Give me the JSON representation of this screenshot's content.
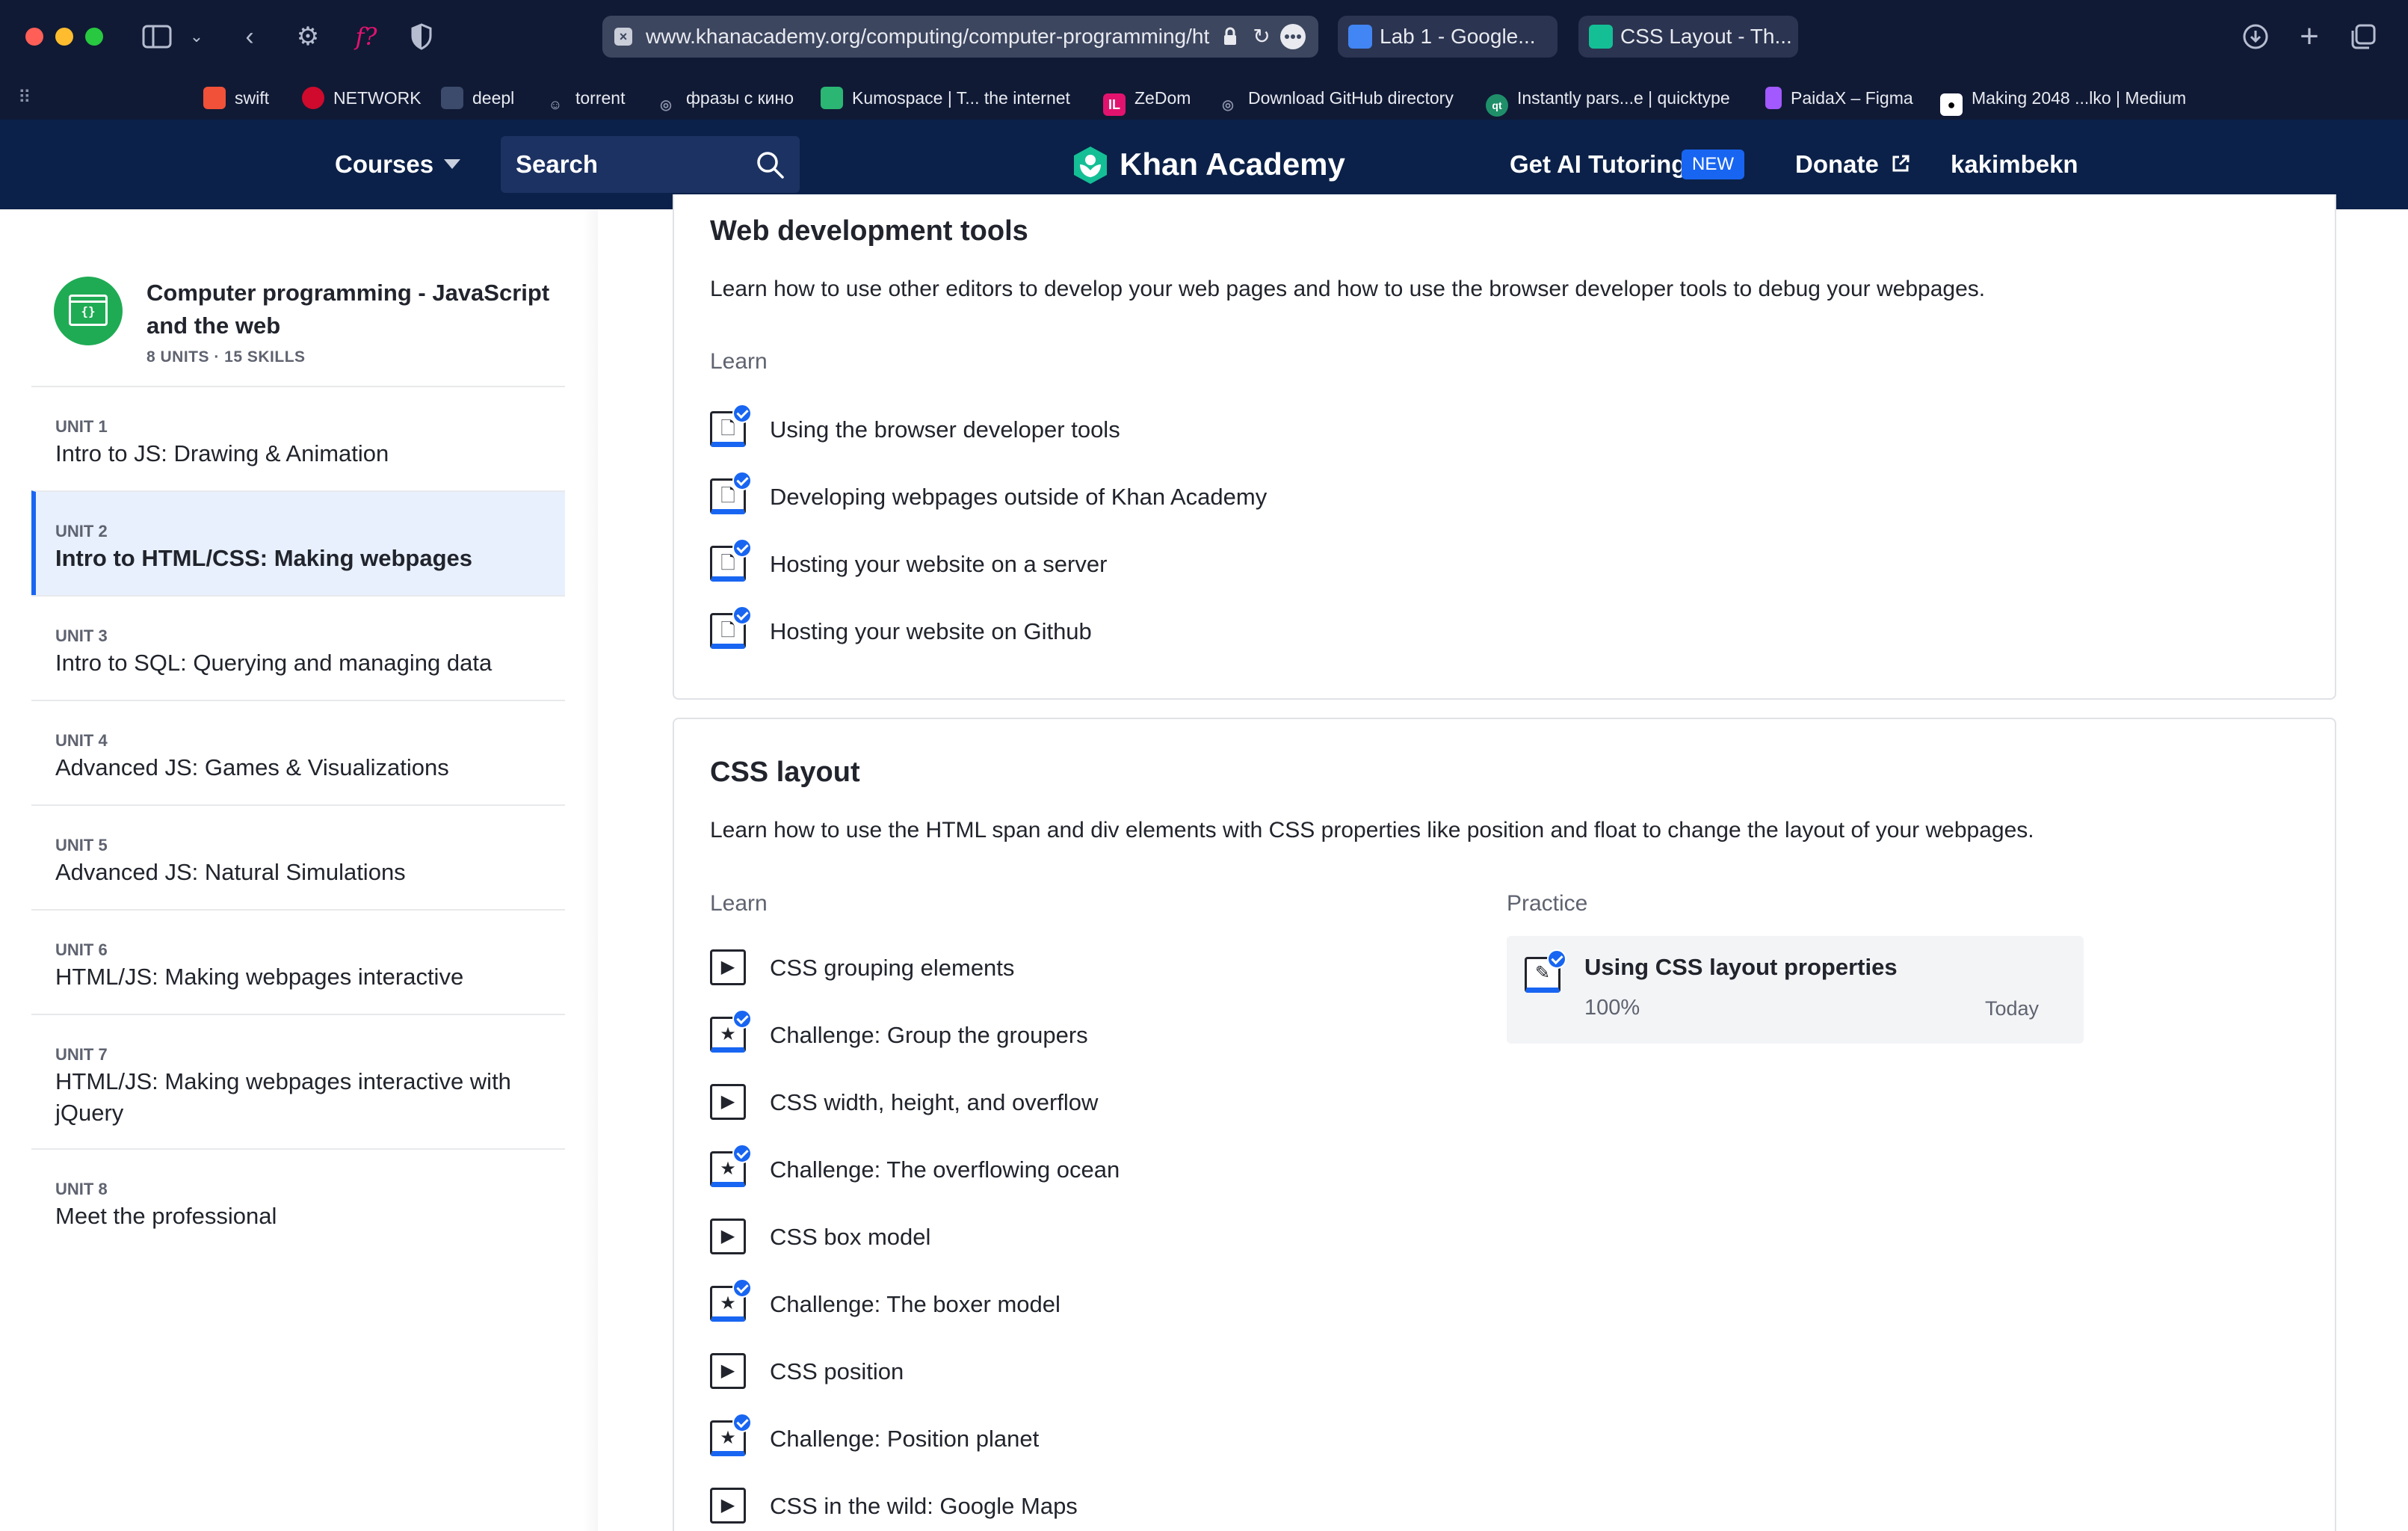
{
  "browser": {
    "url": "www.khanacademy.org/computing/computer-programming/ht",
    "tabs": [
      {
        "label": "Lab 1 - Google...",
        "favicon_color": "#4285f4"
      },
      {
        "label": "CSS Layout - Th...",
        "favicon_color": "#14bf96"
      }
    ],
    "bookmarks": [
      {
        "label": "swift",
        "icon_color": "#f05138"
      },
      {
        "label": "NETWORK",
        "icon_color": "#cf0a2c"
      },
      {
        "label": "deepl",
        "icon_color": "#3c4a6b"
      },
      {
        "label": "torrent",
        "icon_color": "#6f7890"
      },
      {
        "label": "фразы с кино",
        "icon_color": "#6f7890"
      },
      {
        "label": "Kumospace | T... the internet",
        "icon_color": "#2bb673"
      },
      {
        "label": "ZeDom",
        "icon_color": "#e2136e"
      },
      {
        "label": "Download GitHub directory",
        "icon_color": "#6f7890"
      },
      {
        "label": "Instantly pars...e | quicktype",
        "icon_color": "#1f8f6a"
      },
      {
        "label": "PaidaX – Figma",
        "icon_color": "#a259ff"
      },
      {
        "label": "Making 2048 ...lko | Medium",
        "icon_color": "#ffffff"
      }
    ]
  },
  "header": {
    "courses_label": "Courses",
    "search_placeholder": "Search",
    "logo_text": "Khan Academy",
    "ai_tutoring_label": "Get AI Tutoring",
    "new_badge": "NEW",
    "donate_label": "Donate",
    "username": "kakimbekn",
    "brand_color": "#0b2149",
    "accent_color": "#1865f2"
  },
  "sidebar": {
    "course_title": "Computer programming - JavaScript and the web",
    "course_meta": "8 UNITS · 15 SKILLS",
    "units": [
      {
        "label": "UNIT 1",
        "title": "Intro to JS: Drawing & Animation",
        "active": false
      },
      {
        "label": "UNIT 2",
        "title": "Intro to HTML/CSS: Making webpages",
        "active": true
      },
      {
        "label": "UNIT 3",
        "title": "Intro to SQL: Querying and managing data",
        "active": false
      },
      {
        "label": "UNIT 4",
        "title": "Advanced JS: Games & Visualizations",
        "active": false
      },
      {
        "label": "UNIT 5",
        "title": "Advanced JS: Natural Simulations",
        "active": false
      },
      {
        "label": "UNIT 6",
        "title": "HTML/JS: Making webpages interactive",
        "active": false
      },
      {
        "label": "UNIT 7",
        "title": "HTML/JS: Making webpages interactive with jQuery",
        "active": false
      },
      {
        "label": "UNIT 8",
        "title": "Meet the professional",
        "active": false
      }
    ]
  },
  "lessons": [
    {
      "title": "Web development tools",
      "description": "Learn how to use other editors to develop your web pages and how to use the browser developer tools to debug your webpages.",
      "learn_label": "Learn",
      "items": [
        {
          "label": "Using the browser developer tools",
          "type": "article",
          "completed": true
        },
        {
          "label": "Developing webpages outside of Khan Academy",
          "type": "article",
          "completed": true
        },
        {
          "label": "Hosting your website on a server",
          "type": "article",
          "completed": true
        },
        {
          "label": "Hosting your website on Github",
          "type": "article",
          "completed": true
        }
      ]
    },
    {
      "title": "CSS layout",
      "description": "Learn how to use the HTML span and div elements with CSS properties like position and float to change the layout of your webpages.",
      "learn_label": "Learn",
      "practice_label": "Practice",
      "items": [
        {
          "label": "CSS grouping elements",
          "type": "video",
          "completed": false
        },
        {
          "label": "Challenge: Group the groupers",
          "type": "challenge",
          "completed": true
        },
        {
          "label": "CSS width, height, and overflow",
          "type": "video",
          "completed": false
        },
        {
          "label": "Challenge: The overflowing ocean",
          "type": "challenge",
          "completed": true
        },
        {
          "label": "CSS box model",
          "type": "video",
          "completed": false
        },
        {
          "label": "Challenge: The boxer model",
          "type": "challenge",
          "completed": true
        },
        {
          "label": "CSS position",
          "type": "video",
          "completed": false
        },
        {
          "label": "Challenge: Position planet",
          "type": "challenge",
          "completed": true
        },
        {
          "label": "CSS in the wild: Google Maps",
          "type": "video",
          "completed": false
        }
      ],
      "practice": {
        "title": "Using CSS layout properties",
        "score": "100%",
        "date": "Today"
      }
    }
  ]
}
